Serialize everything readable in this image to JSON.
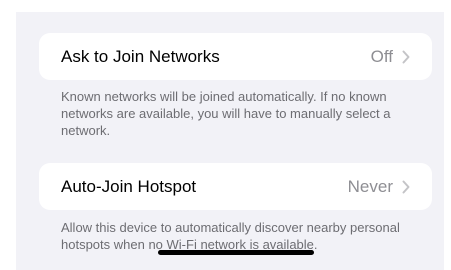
{
  "settings": {
    "ask_to_join": {
      "label": "Ask to Join Networks",
      "value": "Off",
      "footer": "Known networks will be joined automatically. If no known networks are available, you will have to manually select a network."
    },
    "auto_join_hotspot": {
      "label": "Auto-Join Hotspot",
      "value": "Never",
      "footer": "Allow this device to automatically discover nearby personal hotspots when no Wi-Fi network is available."
    }
  },
  "icons": {
    "chevron": "chevron-right-icon"
  },
  "colors": {
    "background": "#f2f2f7",
    "cell": "#ffffff",
    "secondary_text": "#8e8e93",
    "footer_text": "#6d6d72"
  }
}
